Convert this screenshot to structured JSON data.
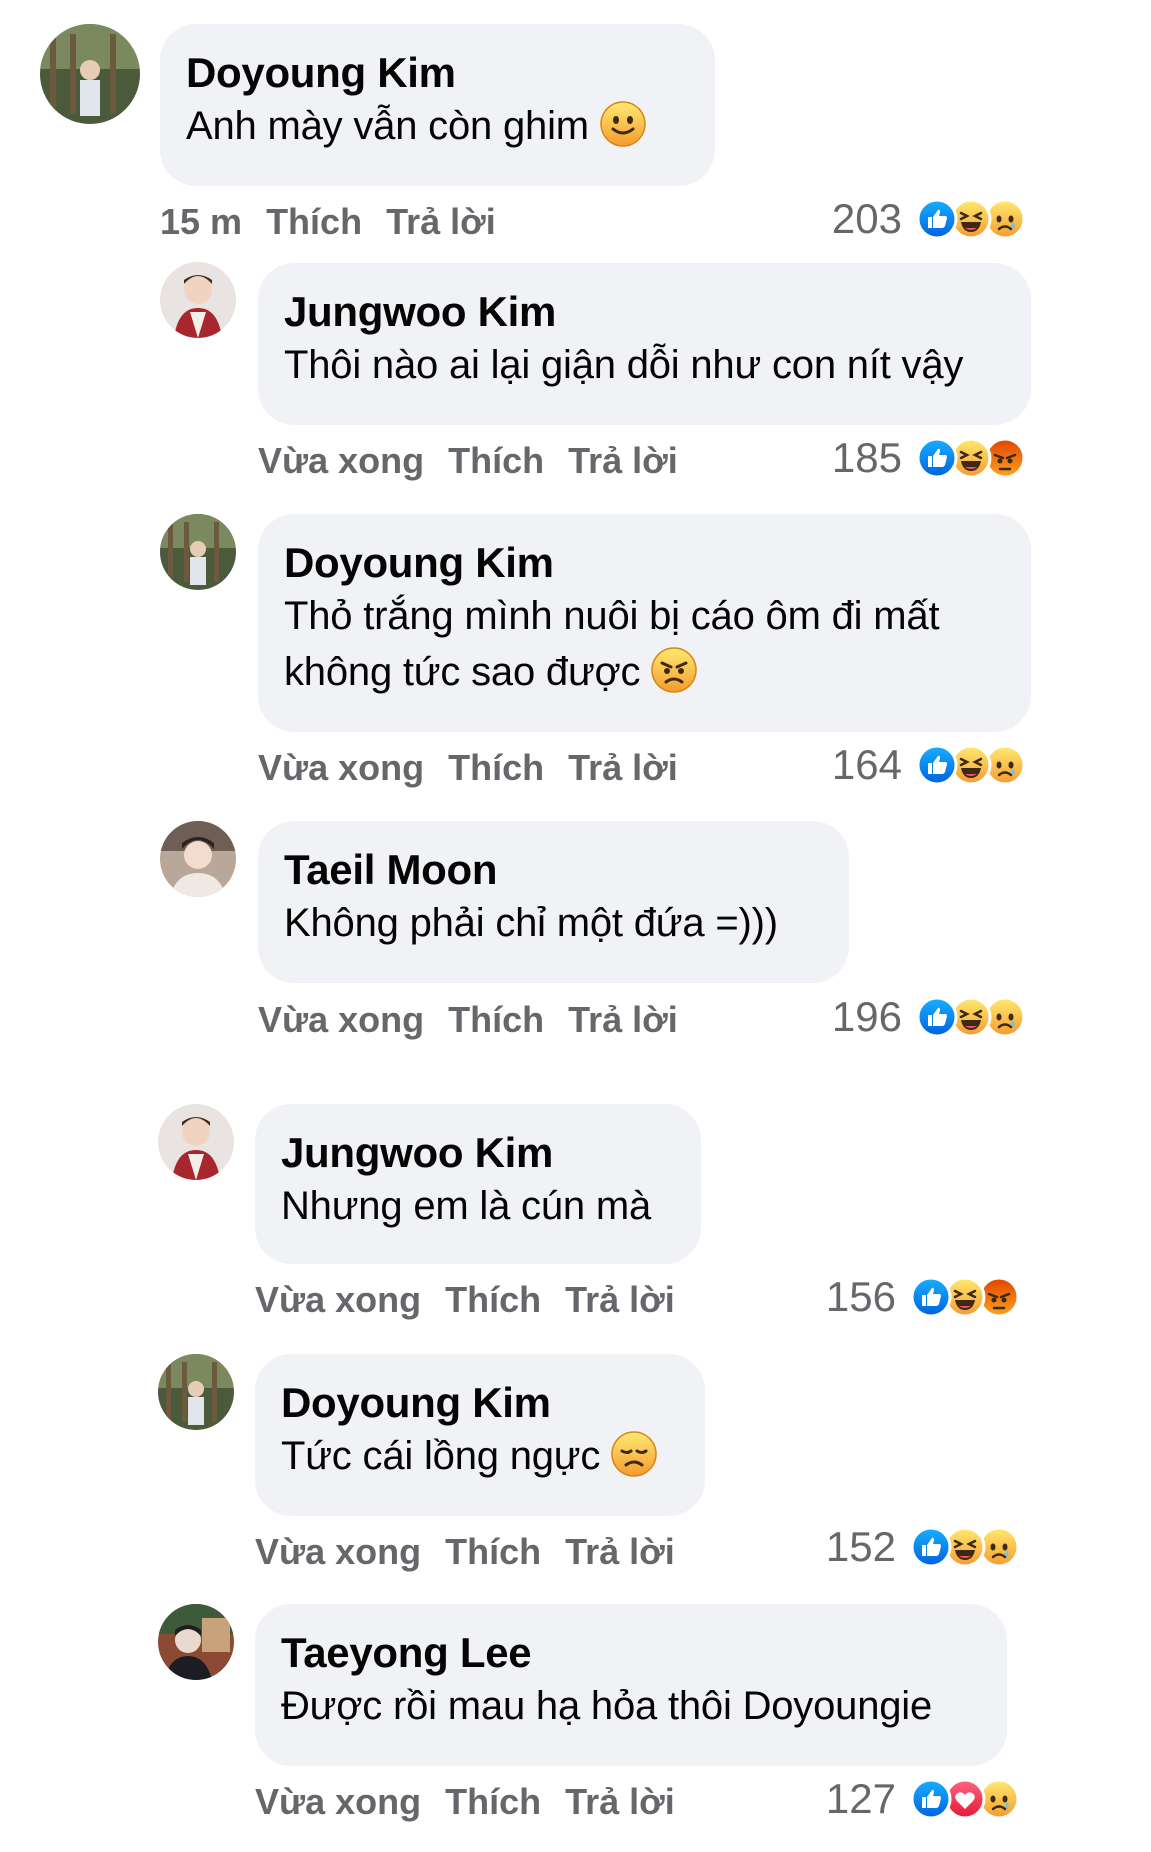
{
  "comments": [
    {
      "author": "Doyoung Kim",
      "line1": "Anh mày vẫn còn ghim",
      "line2": "",
      "emoji": "smile-emoji",
      "time": "15 m",
      "like": "Thích",
      "reply": "Trả lời",
      "count": "203",
      "reactions": [
        "like-reaction",
        "haha-reaction",
        "sad-reaction"
      ]
    },
    {
      "author": "Jungwoo Kim",
      "line1": "Thôi nào ai lại giận dỗi như con nít vậy",
      "line2": "",
      "emoji": "",
      "time": "Vừa xong",
      "like": "Thích",
      "reply": "Trả lời",
      "count": "185",
      "reactions": [
        "like-reaction",
        "haha-reaction",
        "angry-reaction"
      ]
    },
    {
      "author": "Doyoung Kim",
      "line1": "Thỏ trắng mình nuôi bị cáo ôm đi mất",
      "line2": "không tức sao được",
      "emoji": "angry-emoji",
      "time": "Vừa xong",
      "like": "Thích",
      "reply": "Trả lời",
      "count": "164",
      "reactions": [
        "like-reaction",
        "haha-reaction",
        "sad-reaction"
      ]
    },
    {
      "author": "Taeil Moon",
      "line1": "Không phải chỉ một đứa =)))",
      "line2": "",
      "emoji": "",
      "time": "Vừa xong",
      "like": "Thích",
      "reply": "Trả lời",
      "count": "196",
      "reactions": [
        "like-reaction",
        "haha-reaction",
        "sad-reaction"
      ]
    },
    {
      "author": "Jungwoo Kim",
      "line1": "Nhưng em là cún mà",
      "line2": "",
      "emoji": "",
      "time": "Vừa xong",
      "like": "Thích",
      "reply": "Trả lời",
      "count": "156",
      "reactions": [
        "like-reaction",
        "haha-reaction",
        "angry-reaction"
      ]
    },
    {
      "author": "Doyoung Kim",
      "line1": "Tức cái lồng ngực",
      "line2": "",
      "emoji": "disappointed-emoji",
      "time": "Vừa xong",
      "like": "Thích",
      "reply": "Trả lời",
      "count": "152",
      "reactions": [
        "like-reaction",
        "haha-reaction",
        "sad-reaction"
      ]
    },
    {
      "author": "Taeyong Lee",
      "line1": "Được rồi mau hạ hỏa thôi Doyoungie",
      "line2": "",
      "emoji": "",
      "time": "Vừa xong",
      "like": "Thích",
      "reply": "Trả lời",
      "count": "127",
      "reactions": [
        "like-reaction",
        "love-reaction",
        "sad-reaction"
      ]
    }
  ],
  "colors": {
    "bubble": "#f0f2f5",
    "meta": "#65676b",
    "like": "#1877f2",
    "love": "#f33e58",
    "emoji": "#f7b125"
  }
}
